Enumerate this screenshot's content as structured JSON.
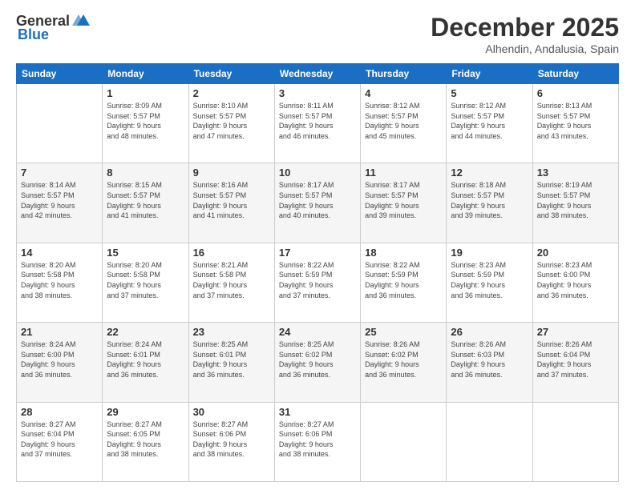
{
  "header": {
    "logo": {
      "general": "General",
      "blue": "Blue"
    },
    "title": "December 2025",
    "subtitle": "Alhendin, Andalusia, Spain"
  },
  "calendar": {
    "days_of_week": [
      "Sunday",
      "Monday",
      "Tuesday",
      "Wednesday",
      "Thursday",
      "Friday",
      "Saturday"
    ],
    "weeks": [
      [
        {
          "day": "",
          "info": ""
        },
        {
          "day": "1",
          "info": "Sunrise: 8:09 AM\nSunset: 5:57 PM\nDaylight: 9 hours\nand 48 minutes."
        },
        {
          "day": "2",
          "info": "Sunrise: 8:10 AM\nSunset: 5:57 PM\nDaylight: 9 hours\nand 47 minutes."
        },
        {
          "day": "3",
          "info": "Sunrise: 8:11 AM\nSunset: 5:57 PM\nDaylight: 9 hours\nand 46 minutes."
        },
        {
          "day": "4",
          "info": "Sunrise: 8:12 AM\nSunset: 5:57 PM\nDaylight: 9 hours\nand 45 minutes."
        },
        {
          "day": "5",
          "info": "Sunrise: 8:12 AM\nSunset: 5:57 PM\nDaylight: 9 hours\nand 44 minutes."
        },
        {
          "day": "6",
          "info": "Sunrise: 8:13 AM\nSunset: 5:57 PM\nDaylight: 9 hours\nand 43 minutes."
        }
      ],
      [
        {
          "day": "7",
          "info": "Sunrise: 8:14 AM\nSunset: 5:57 PM\nDaylight: 9 hours\nand 42 minutes."
        },
        {
          "day": "8",
          "info": "Sunrise: 8:15 AM\nSunset: 5:57 PM\nDaylight: 9 hours\nand 41 minutes."
        },
        {
          "day": "9",
          "info": "Sunrise: 8:16 AM\nSunset: 5:57 PM\nDaylight: 9 hours\nand 41 minutes."
        },
        {
          "day": "10",
          "info": "Sunrise: 8:17 AM\nSunset: 5:57 PM\nDaylight: 9 hours\nand 40 minutes."
        },
        {
          "day": "11",
          "info": "Sunrise: 8:17 AM\nSunset: 5:57 PM\nDaylight: 9 hours\nand 39 minutes."
        },
        {
          "day": "12",
          "info": "Sunrise: 8:18 AM\nSunset: 5:57 PM\nDaylight: 9 hours\nand 39 minutes."
        },
        {
          "day": "13",
          "info": "Sunrise: 8:19 AM\nSunset: 5:57 PM\nDaylight: 9 hours\nand 38 minutes."
        }
      ],
      [
        {
          "day": "14",
          "info": "Sunrise: 8:20 AM\nSunset: 5:58 PM\nDaylight: 9 hours\nand 38 minutes."
        },
        {
          "day": "15",
          "info": "Sunrise: 8:20 AM\nSunset: 5:58 PM\nDaylight: 9 hours\nand 37 minutes."
        },
        {
          "day": "16",
          "info": "Sunrise: 8:21 AM\nSunset: 5:58 PM\nDaylight: 9 hours\nand 37 minutes."
        },
        {
          "day": "17",
          "info": "Sunrise: 8:22 AM\nSunset: 5:59 PM\nDaylight: 9 hours\nand 37 minutes."
        },
        {
          "day": "18",
          "info": "Sunrise: 8:22 AM\nSunset: 5:59 PM\nDaylight: 9 hours\nand 36 minutes."
        },
        {
          "day": "19",
          "info": "Sunrise: 8:23 AM\nSunset: 5:59 PM\nDaylight: 9 hours\nand 36 minutes."
        },
        {
          "day": "20",
          "info": "Sunrise: 8:23 AM\nSunset: 6:00 PM\nDaylight: 9 hours\nand 36 minutes."
        }
      ],
      [
        {
          "day": "21",
          "info": "Sunrise: 8:24 AM\nSunset: 6:00 PM\nDaylight: 9 hours\nand 36 minutes."
        },
        {
          "day": "22",
          "info": "Sunrise: 8:24 AM\nSunset: 6:01 PM\nDaylight: 9 hours\nand 36 minutes."
        },
        {
          "day": "23",
          "info": "Sunrise: 8:25 AM\nSunset: 6:01 PM\nDaylight: 9 hours\nand 36 minutes."
        },
        {
          "day": "24",
          "info": "Sunrise: 8:25 AM\nSunset: 6:02 PM\nDaylight: 9 hours\nand 36 minutes."
        },
        {
          "day": "25",
          "info": "Sunrise: 8:26 AM\nSunset: 6:02 PM\nDaylight: 9 hours\nand 36 minutes."
        },
        {
          "day": "26",
          "info": "Sunrise: 8:26 AM\nSunset: 6:03 PM\nDaylight: 9 hours\nand 36 minutes."
        },
        {
          "day": "27",
          "info": "Sunrise: 8:26 AM\nSunset: 6:04 PM\nDaylight: 9 hours\nand 37 minutes."
        }
      ],
      [
        {
          "day": "28",
          "info": "Sunrise: 8:27 AM\nSunset: 6:04 PM\nDaylight: 9 hours\nand 37 minutes."
        },
        {
          "day": "29",
          "info": "Sunrise: 8:27 AM\nSunset: 6:05 PM\nDaylight: 9 hours\nand 38 minutes."
        },
        {
          "day": "30",
          "info": "Sunrise: 8:27 AM\nSunset: 6:06 PM\nDaylight: 9 hours\nand 38 minutes."
        },
        {
          "day": "31",
          "info": "Sunrise: 8:27 AM\nSunset: 6:06 PM\nDaylight: 9 hours\nand 38 minutes."
        },
        {
          "day": "",
          "info": ""
        },
        {
          "day": "",
          "info": ""
        },
        {
          "day": "",
          "info": ""
        }
      ]
    ]
  }
}
